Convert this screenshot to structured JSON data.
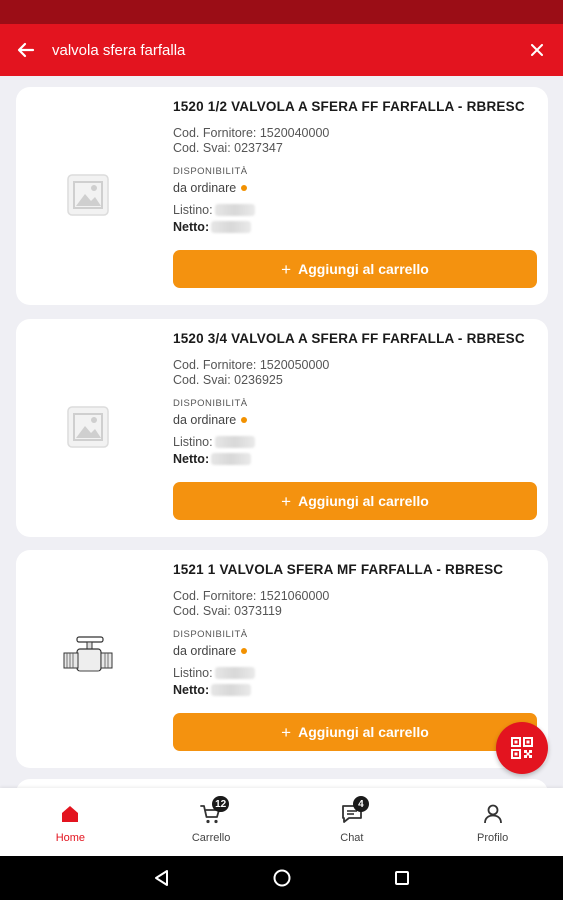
{
  "search": {
    "query": "valvola sfera farfalla"
  },
  "products": [
    {
      "title": "1520 1/2 VALVOLA A SFERA FF FARFALLA - RBRESC",
      "supplier_code": "Cod. Fornitore: 1520040000",
      "svai_code": "Cod. Svai: 0237347",
      "availability_label": "DISPONIBILITÀ",
      "availability_value": "da ordinare",
      "list_label": "Listino:",
      "net_label": "Netto:",
      "add_label": "Aggiungi al carrello",
      "image": "image-placeholder-icon"
    },
    {
      "title": "1520 3/4 VALVOLA A SFERA FF FARFALLA - RBRESC",
      "supplier_code": "Cod. Fornitore: 1520050000",
      "svai_code": "Cod. Svai: 0236925",
      "availability_label": "DISPONIBILITÀ",
      "availability_value": "da ordinare",
      "list_label": "Listino:",
      "net_label": "Netto:",
      "add_label": "Aggiungi al carrello",
      "image": "image-placeholder-icon"
    },
    {
      "title": "1521 1 VALVOLA SFERA MF FARFALLA - RBRESC",
      "supplier_code": "Cod. Fornitore: 1521060000",
      "svai_code": "Cod. Svai: 0373119",
      "availability_label": "DISPONIBILITÀ",
      "availability_value": "da ordinare",
      "list_label": "Listino:",
      "net_label": "Netto:",
      "add_label": "Aggiungi al carrello",
      "image": "ball-valve-product-image"
    }
  ],
  "nav": {
    "home": "Home",
    "cart": "Carrello",
    "cart_badge": "12",
    "chat": "Chat",
    "chat_badge": "4",
    "profile": "Profilo"
  },
  "colors": {
    "primary": "#e3141f",
    "status_bar": "#9b0d16",
    "accent": "#f4920f",
    "availability_dot": "#f29100"
  }
}
